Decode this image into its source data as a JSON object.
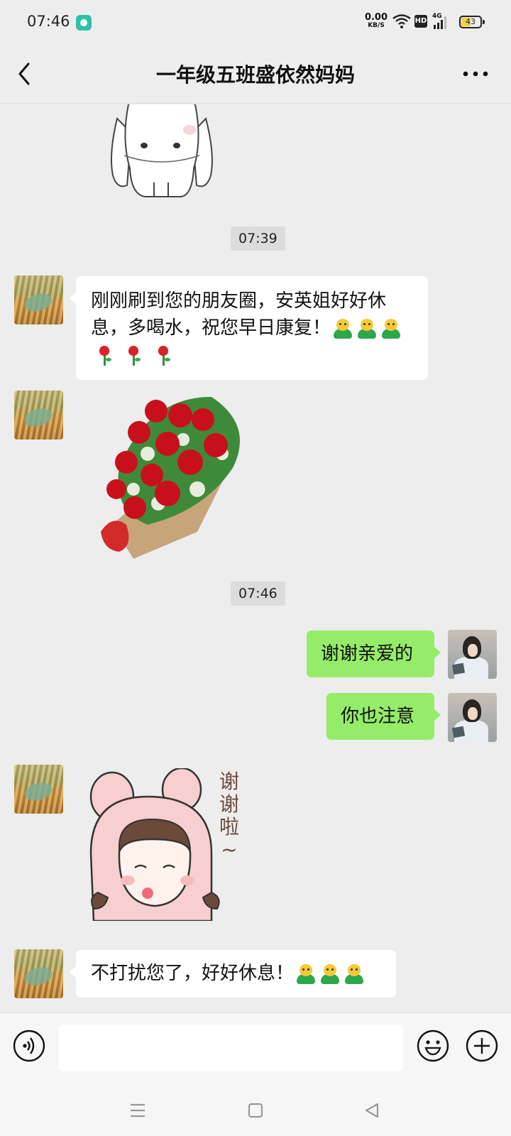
{
  "status_bar": {
    "time": "07:46",
    "net_speed_value": "0.00",
    "net_speed_unit": "KB/S",
    "hd_label": "HD",
    "network_label": "4G",
    "battery_level": "43",
    "notification_icon": "chat-bubble-icon",
    "wifi_icon": "wifi-icon",
    "signal_icon": "signal-icon",
    "battery_icon": "battery-icon"
  },
  "header": {
    "title": "一年级五班盛依然妈妈",
    "back_icon": "chevron-left-icon",
    "more_icon": "more-dots-icon"
  },
  "chat": {
    "timestamps": [
      "07:39",
      "07:46"
    ],
    "messages": [
      {
        "sender": "friend",
        "type": "sticker",
        "sticker": "white-rabbit-sticker"
      },
      {
        "sender": "friend",
        "type": "text",
        "line1": "刚刚刷到您的朋友圈，安英姐好好休",
        "line2": "息，多喝水，祝您早日康复！",
        "emoji_after": [
          "hug-emoji",
          "hug-emoji",
          "hug-emoji"
        ],
        "emoji_line3": [
          "rose-emoji",
          "rose-emoji",
          "rose-emoji"
        ]
      },
      {
        "sender": "friend",
        "type": "sticker",
        "sticker": "rose-bouquet-sticker"
      },
      {
        "sender": "self",
        "type": "text",
        "text": "谢谢亲爱的"
      },
      {
        "sender": "self",
        "type": "text",
        "text": "你也注意"
      },
      {
        "sender": "friend",
        "type": "sticker",
        "sticker": "bunny-girl-thanks-sticker",
        "sticker_text": [
          "谢",
          "谢",
          "啦",
          "~"
        ]
      },
      {
        "sender": "friend",
        "type": "text",
        "text": "不打扰您了，好好休息！",
        "emoji_after": [
          "hug-emoji",
          "hug-emoji",
          "hug-emoji"
        ]
      }
    ]
  },
  "input_bar": {
    "value": "",
    "voice_icon": "voice-icon",
    "emoji_icon": "smiley-icon",
    "plus_icon": "plus-icon"
  },
  "nav_bar": {
    "items": [
      "menu-icon",
      "home-square-icon",
      "back-triangle-icon"
    ]
  },
  "colors": {
    "background": "#ededed",
    "self_bubble": "#95ec69",
    "friend_bubble": "#ffffff",
    "timestamp_bg": "#dcdcdc"
  }
}
